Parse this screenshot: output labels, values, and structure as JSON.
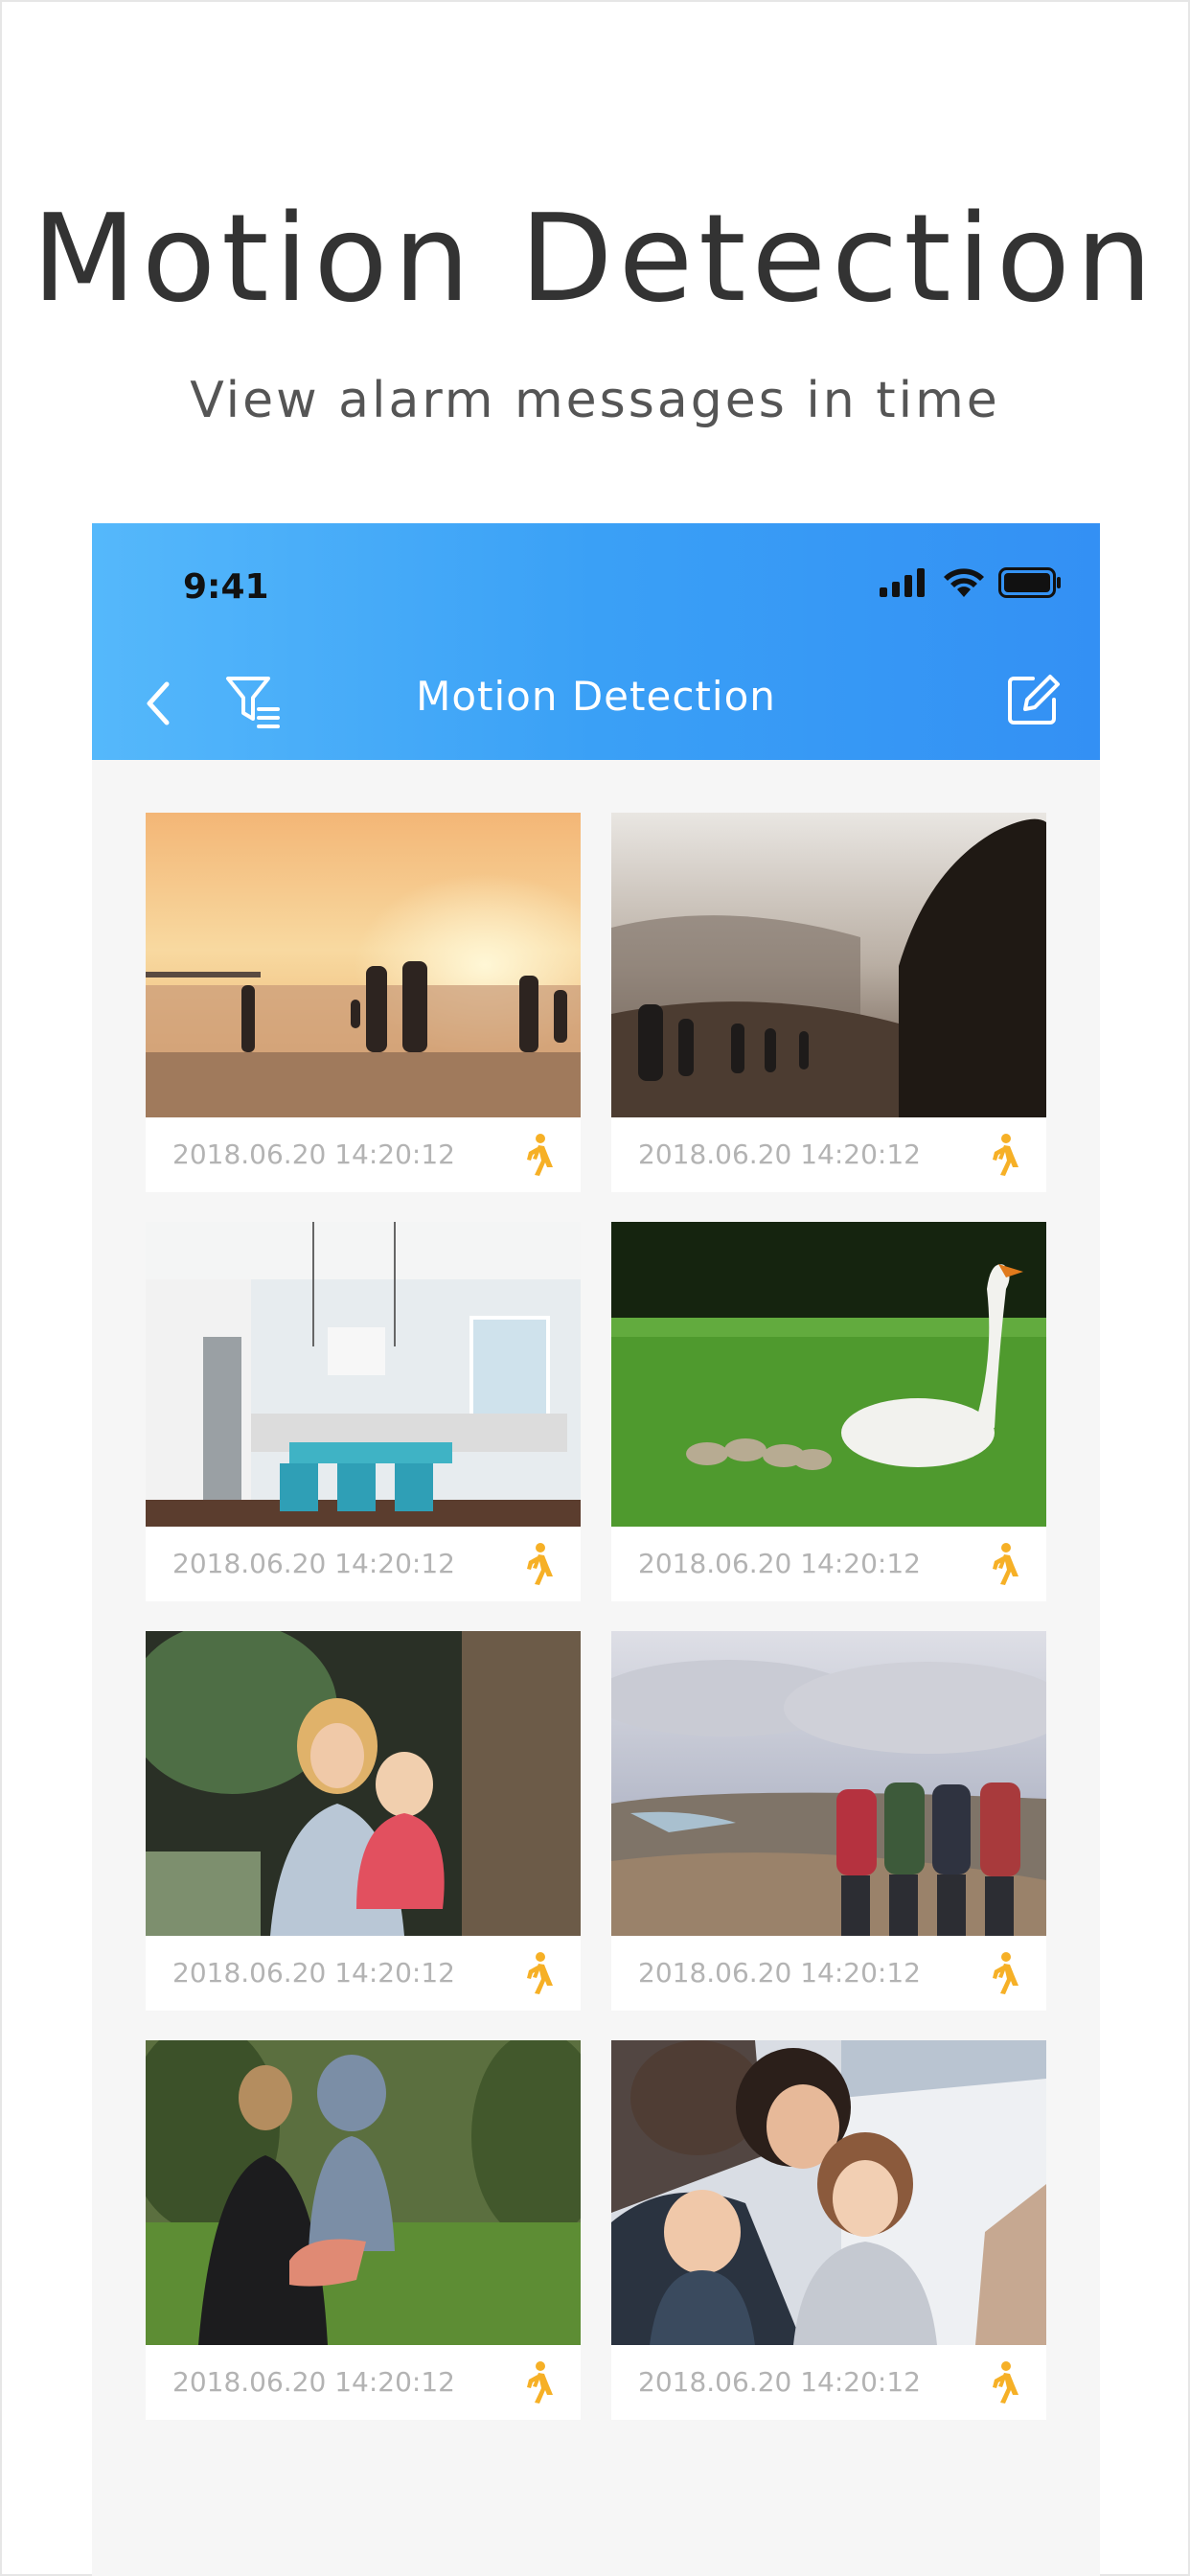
{
  "promo": {
    "title": "Motion Detection",
    "subtitle": "View alarm messages in time"
  },
  "status_bar": {
    "time": "9:41",
    "icons": [
      "signal-icon",
      "wifi-icon",
      "battery-icon"
    ]
  },
  "nav": {
    "title": "Motion Detection",
    "icons": [
      "back-chevron-icon",
      "filter-icon",
      "edit-icon"
    ]
  },
  "colors": {
    "appbar_start": "#55b8fb",
    "appbar_end": "#3390f4",
    "motion_icon": "#f6b026",
    "timestamp": "#b3b3b3",
    "list_background": "#f6f6f6"
  },
  "events": [
    {
      "time": "2018.06.20 14:20:12",
      "icon": "motion-walk-icon",
      "thumbnail": "beach-sunset"
    },
    {
      "time": "2018.06.20 14:20:12",
      "icon": "motion-walk-icon",
      "thumbnail": "hillside-hikers"
    },
    {
      "time": "2018.06.20 14:20:12",
      "icon": "motion-walk-icon",
      "thumbnail": "kitchen"
    },
    {
      "time": "2018.06.20 14:20:12",
      "icon": "motion-walk-icon",
      "thumbnail": "swan-and-cygnets"
    },
    {
      "time": "2018.06.20 14:20:12",
      "icon": "motion-walk-icon",
      "thumbnail": "mother-and-baby"
    },
    {
      "time": "2018.06.20 14:20:12",
      "icon": "motion-walk-icon",
      "thumbnail": "hikers-overlook"
    },
    {
      "time": "2018.06.20 14:20:12",
      "icon": "motion-walk-icon",
      "thumbnail": "parent-carrying-child"
    },
    {
      "time": "2018.06.20 14:20:12",
      "icon": "motion-walk-icon",
      "thumbnail": "family-in-snow"
    }
  ]
}
